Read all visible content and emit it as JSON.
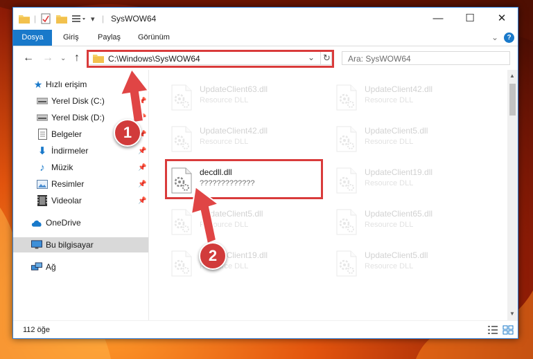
{
  "window": {
    "title": "SysWOW64"
  },
  "ribbon": {
    "tabs": [
      "Dosya",
      "Giriş",
      "Paylaş",
      "Görünüm"
    ],
    "help": "?"
  },
  "address": {
    "path": "C:\\Windows\\SysWOW64",
    "search_placeholder": "Ara: SysWOW64"
  },
  "sidebar": {
    "quick_access": "Hızlı erişim",
    "items": [
      {
        "label": "Yerel Disk (C:)",
        "icon": "drive-icon",
        "pinned": true
      },
      {
        "label": "Yerel Disk (D:)",
        "icon": "drive-icon",
        "pinned": true
      },
      {
        "label": "Belgeler",
        "icon": "documents-icon",
        "pinned": true
      },
      {
        "label": "İndirmeler",
        "icon": "downloads-icon",
        "pinned": true
      },
      {
        "label": "Müzik",
        "icon": "music-icon",
        "pinned": true
      },
      {
        "label": "Resimler",
        "icon": "pictures-icon",
        "pinned": true
      },
      {
        "label": "Videolar",
        "icon": "videos-icon",
        "pinned": true
      }
    ],
    "onedrive": "OneDrive",
    "this_pc": "Bu bilgisayar",
    "network": "Ağ"
  },
  "files": [
    {
      "name": "UpdateClient63.dll",
      "desc": "Resource DLL",
      "faded": true
    },
    {
      "name": "UpdateClient42.dll",
      "desc": "Resource DLL",
      "faded": true
    },
    {
      "name": "UpdateClient42.dll",
      "desc": "Resource DLL",
      "faded": true
    },
    {
      "name": "UpdateClient5.dll",
      "desc": "Resource DLL",
      "faded": true
    },
    {
      "name": "decdll.dll",
      "desc": "?????????????",
      "faded": false
    },
    {
      "name": "UpdateClient19.dll",
      "desc": "Resource DLL",
      "faded": true
    },
    {
      "name": "UpdateClient5.dll",
      "desc": "Resource DLL",
      "faded": true
    },
    {
      "name": "UpdateClient65.dll",
      "desc": "Resource DLL",
      "faded": true
    },
    {
      "name": "UpdateClient19.dll",
      "desc": "Resource DLL",
      "faded": true
    },
    {
      "name": "UpdateClient5.dll",
      "desc": "Resource DLL",
      "faded": true
    }
  ],
  "status": {
    "item_count": "112 öğe"
  },
  "annotations": {
    "step1": "1",
    "step2": "2"
  },
  "colors": {
    "accent": "#1979ca",
    "highlight": "#d93b3b",
    "badge": "#d13b3b"
  }
}
